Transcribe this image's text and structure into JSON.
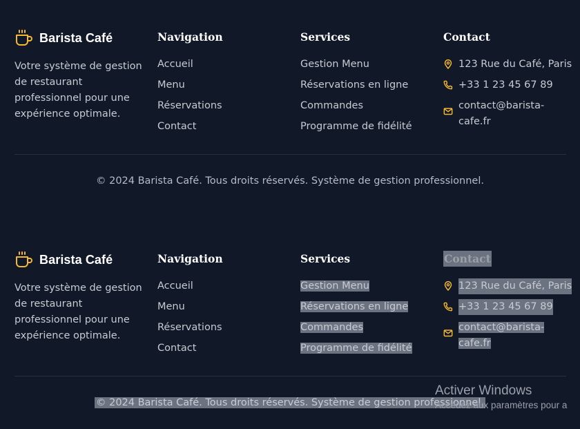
{
  "brand": {
    "name": "Barista Café",
    "icon": "coffee-cup-icon",
    "accent": "#f5b830"
  },
  "description": "Votre système de gestion de restaurant professionnel pour une expérience optimale.",
  "navigation": {
    "title": "Navigation",
    "items": [
      "Accueil",
      "Menu",
      "Réservations",
      "Contact"
    ]
  },
  "services": {
    "title": "Services",
    "items": [
      "Gestion Menu",
      "Réservations en ligne",
      "Commandes",
      "Programme de fidélité"
    ]
  },
  "contact": {
    "title": "Contact",
    "address": "123 Rue du Café, Paris",
    "phone": "+33 1 23 45 67 89",
    "email": "contact@barista-cafe.fr",
    "icons": [
      "map-pin-icon",
      "phone-icon",
      "mail-icon"
    ]
  },
  "copyright": "© 2024 Barista Café. Tous droits réservés. Système de gestion professionnel.",
  "watermark": {
    "line1": "Activer Windows",
    "line2": "Accédez aux paramètres pour a"
  },
  "colors": {
    "background": "#111827",
    "accent": "#f5b830",
    "selection": "#6b7280"
  }
}
